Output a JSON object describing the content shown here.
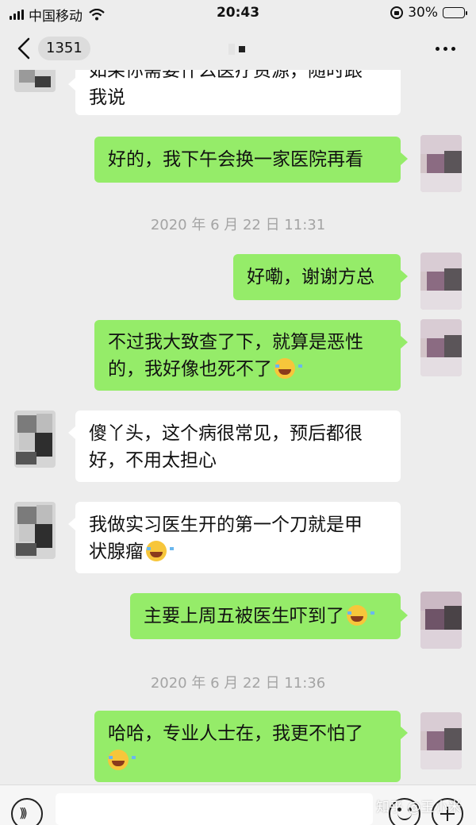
{
  "status_bar": {
    "carrier": "中国移动",
    "time": "20:43",
    "battery": "30%",
    "battery_level": 0.3
  },
  "nav": {
    "unread_count": "1351"
  },
  "messages": [
    {
      "side": "in",
      "lines": [
        "如果你需要什么医疗资源，随时跟",
        "我说"
      ]
    },
    {
      "side": "out",
      "lines": [
        "好的，我下午会换一家医院再看"
      ]
    },
    {
      "time": "2020 年 6 月 22 日 11:31"
    },
    {
      "side": "out",
      "lines": [
        "好嘞，谢谢方总"
      ]
    },
    {
      "side": "out",
      "lines": [
        "不过我大致查了下，就算是恶性",
        "的，我好像也死不了"
      ],
      "emoji": "laughing-tears-emoji"
    },
    {
      "side": "in",
      "lines": [
        "傻丫头，这个病很常见，预后都很",
        "好，不用太担心"
      ]
    },
    {
      "side": "in",
      "lines": [
        "我做实习医生开的第一个刀就是甲",
        "状腺瘤"
      ],
      "emoji": "rolling-laughing-emoji"
    },
    {
      "side": "out",
      "lines": [
        "主要上周五被医生吓到了"
      ],
      "emoji": "rolling-laughing-emoji"
    },
    {
      "time": "2020 年 6 月 22 日 11:36"
    },
    {
      "side": "out",
      "lines": [
        "哈哈，专业人士在，我更不怕了",
        ""
      ],
      "emoji": "laughing-tears-emoji"
    }
  ],
  "watermark": "知乎 @王小米",
  "icons": {
    "back": "chevron-left-icon",
    "more": "more-dots-icon",
    "voice": "voice-icon",
    "emoji": "emoji-icon",
    "plus": "plus-icon"
  }
}
